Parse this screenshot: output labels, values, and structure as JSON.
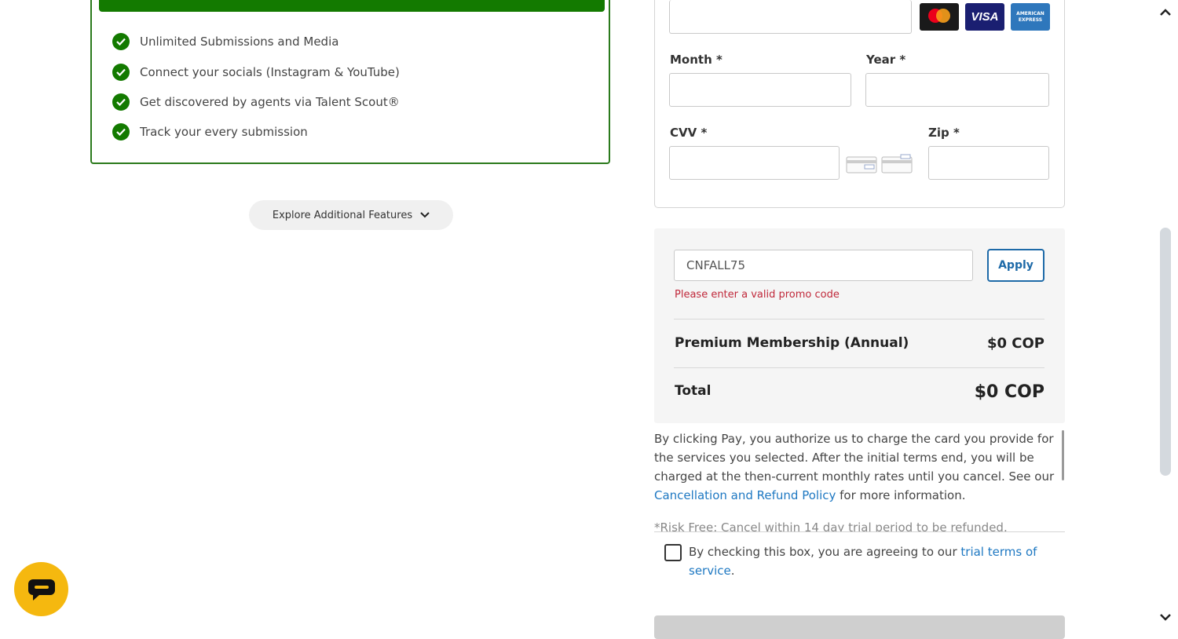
{
  "plan": {
    "features": [
      "Unlimited Submissions and Media",
      "Connect your socials (Instagram & YouTube)",
      "Get discovered by agents via Talent Scout®",
      "Track your every submission"
    ],
    "explore_label": "Explore Additional Features"
  },
  "payment": {
    "month_label": "Month *",
    "year_label": "Year *",
    "cvv_label": "CVV *",
    "zip_label": "Zip *",
    "card_logos": [
      "mastercard-logo",
      "visa-logo",
      "amex-logo"
    ],
    "visa_text": "VISA",
    "amex_text": "AMERICAN EXPRESS"
  },
  "promo": {
    "value": "CNFALL75",
    "apply_label": "Apply",
    "error": "Please enter a valid promo code"
  },
  "summary": {
    "item_label": "Premium Membership (Annual)",
    "item_value": "$0 COP",
    "total_label": "Total",
    "total_value": "$0 COP"
  },
  "legal": {
    "text_before": "By clicking Pay, you authorize us to charge the card you provide for the services you selected. After the initial terms end, you will be charged at the then-current monthly rates until you cancel. See our ",
    "link": "Cancellation and Refund Policy",
    "text_after": " for more information.",
    "cutoff": "*Risk Free: Cancel within 14 day trial period to be refunded."
  },
  "agreement": {
    "text": "By checking this box, you are agreeing to our ",
    "link": "trial terms of service",
    "end": "."
  },
  "colors": {
    "accent_green": "#137a00",
    "link_blue": "#1e78c2",
    "error_red": "#c0283a",
    "chat_yellow": "#f5b80f"
  }
}
